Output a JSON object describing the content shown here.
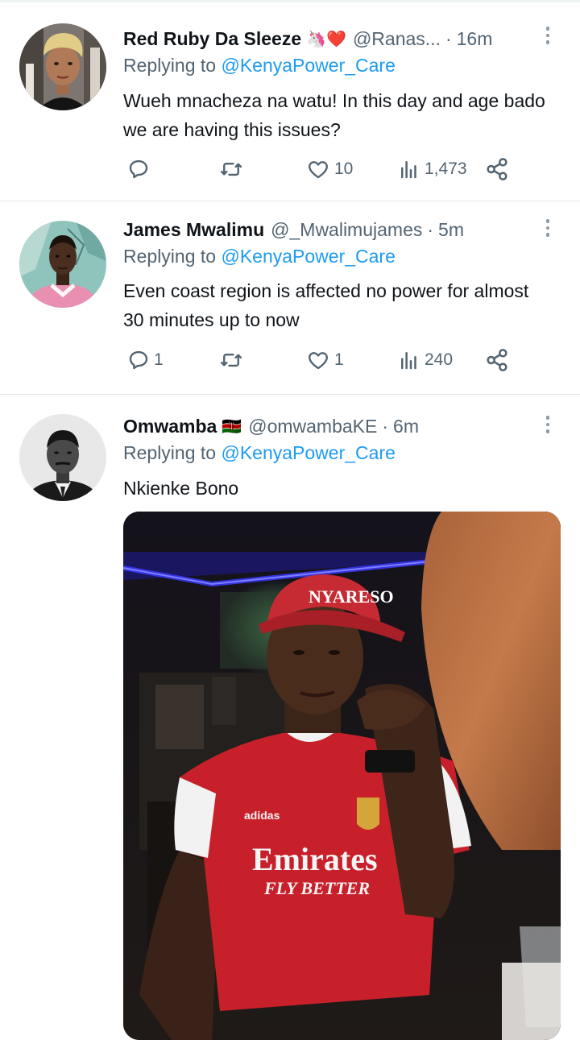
{
  "tweets": [
    {
      "name": "Red Ruby Da Sleeze",
      "emoji": "🦄❤️",
      "handle": "@Ranas...",
      "time": "16m",
      "replying_prefix": "Replying to",
      "replying_to": "@KenyaPower_Care",
      "text": "Wueh mnacheza na watu! In this day and age bado we are having this issues?",
      "replies": "",
      "retweets": "",
      "likes": "10",
      "views": "1,473"
    },
    {
      "name": "James Mwalimu",
      "emoji": "",
      "handle": "@_Mwalimujames",
      "time": "5m",
      "replying_prefix": "Replying to",
      "replying_to": "@KenyaPower_Care",
      "text": "Even coast region is affected no power for almost 30 minutes up to now",
      "replies": "1",
      "retweets": "",
      "likes": "1",
      "views": "240"
    },
    {
      "name": "Omwamba",
      "emoji": "🇰🇪",
      "handle": "@omwambaKE",
      "time": "6m",
      "replying_prefix": "Replying to",
      "replying_to": "@KenyaPower_Care",
      "text": "Nkienke Bono",
      "photo": {
        "cap_text": "NYARESO",
        "shirt_sponsor": "Emirates",
        "shirt_tagline": "FLY BETTER",
        "shirt_brand": "adidas"
      }
    }
  ],
  "dot": "·",
  "colors": {
    "link": "#1d9bf0",
    "muted": "#536471",
    "divider": "#dfe3e6"
  }
}
